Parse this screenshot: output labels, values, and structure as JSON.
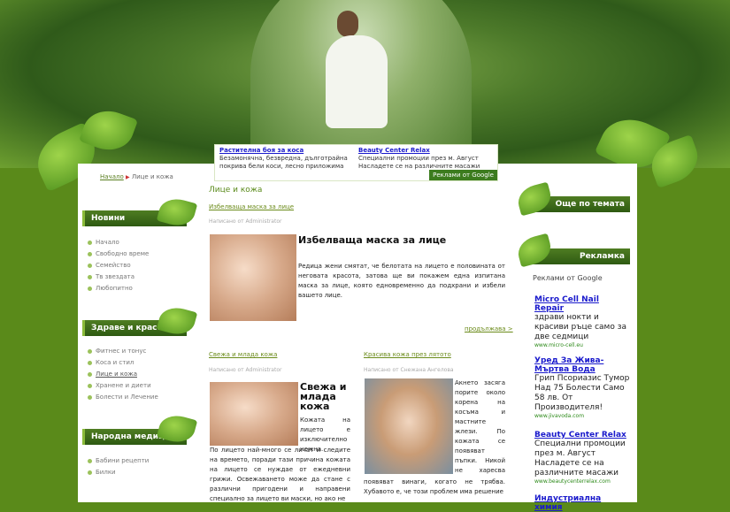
{
  "top_ads": [
    {
      "title": "Растителна боя за коса",
      "text": "Безамонячна, безвредна, дълготрайна покрива бели коси, лесно приложима"
    },
    {
      "title": "Beauty Center Relax",
      "text": "Специални промоции през м. Август Насладете се на различните масажи"
    }
  ],
  "ads_by_google": "Реклами от Google",
  "breadcrumb": {
    "home": "Начало",
    "separator": "▶",
    "current": "Лице и кожа"
  },
  "left_boxes": [
    {
      "title": "Новини",
      "items": [
        "Начало",
        "Свободно време",
        "Семейство",
        "Тв звездата",
        "Любопитно"
      ]
    },
    {
      "title": "Здраве и красота",
      "items": [
        "Фитнес и тонус",
        "Коса и стил",
        "Лице и кожа",
        "Хранене и диети",
        "Болести и Лечение"
      ],
      "active_index": 2
    },
    {
      "title": "Народна медицина",
      "items": [
        "Бабини рецепти",
        "Билки"
      ]
    }
  ],
  "main": {
    "section_title": "Лице и кожа",
    "article1": {
      "link": "Избелваща маска за лице",
      "meta": "Написано от Administrator",
      "heading": "Избелваща маска за лице",
      "body": "Редица жени смятат, че белотата на лицето е половината от неговата красота, затова ще ви покажем една изпитана маска за лице, която едновременно да подхрани и избели вашето лице.",
      "more": "продължава >"
    },
    "article2": {
      "link": "Свежа и млада кожа",
      "meta": "Написано от Administrator",
      "heading": "Свежа и млада кожа",
      "body_side": "Кожата на лицето е изключително нежна.",
      "body": "По лицето най-много се личат и следите на времето, поради тази причина кожата на лицето се нуждае от ежедневни грижи. Освежаването може да стане с различни пригодени и направени специално за лицето ви маски, но ако не"
    },
    "article3": {
      "link": "Красива кожа през лятото",
      "meta": "Написано от Снежана Ангелова",
      "body_side": "Акнето засяга порите около корена на косъма и мастните жлези. По кожата се появяват пъпки. Никой не харесва пъпки, а те се",
      "body": "появяват винаги, когато не трябва. Хубавото е, че този проблем има решение"
    }
  },
  "right_boxes": {
    "more_title": "Още по темата",
    "ads_title": "Рекламка",
    "ads_label": "Реклами от Google",
    "ads": [
      {
        "title": "Micro Cell Nail Repair",
        "text": "здрави нокти и красиви ръце само за две седмици",
        "url": "www.micro-cell.eu"
      },
      {
        "title": "Уред За Жива-Мъртва Вода",
        "text": "Грип Псориазис Тумор Над 75 Болести Само 58 лв. От Производителя!",
        "url": "www.jivavoda.com"
      },
      {
        "title": "Beauty Center Relax",
        "text": "Специални промоции през м. Август Насладете се на различните масажи",
        "url": "www.beautycenterrelax.com"
      },
      {
        "title": "Индустриална химия",
        "text": "",
        "url": ""
      }
    ]
  },
  "colors": {
    "brand_green": "#4f7d22",
    "link_blue": "#1a1acc",
    "background": "#5a8a1a"
  }
}
